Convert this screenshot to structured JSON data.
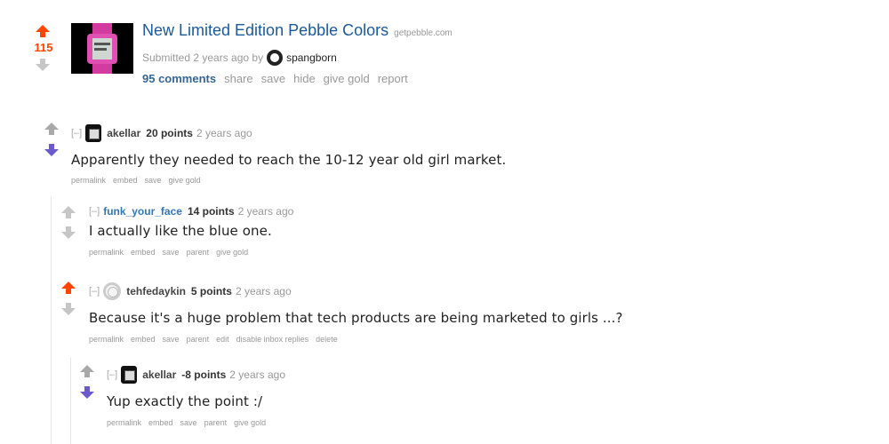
{
  "post": {
    "score": "115",
    "title": "New Limited Edition Pebble Colors",
    "domain": "getpebble.com",
    "submitted_prefix": "Submitted 2 years ago by",
    "author": "spangborn",
    "buttons": {
      "comments": "95 comments",
      "share": "share",
      "save": "save",
      "hide": "hide",
      "give_gold": "give gold",
      "report": "report"
    }
  },
  "comments": [
    {
      "collapse": "[–]",
      "user": "akellar",
      "points": "20 points",
      "time": "2 years ago",
      "body": "Apparently they needed to reach the 10-12 year old girl market.",
      "links": [
        "permalink",
        "embed",
        "save",
        "give gold"
      ]
    },
    {
      "collapse": "[–]",
      "user": "funk_your_face",
      "points": "14 points",
      "time": "2 years ago",
      "body": "I actually like the blue one.",
      "links": [
        "permalink",
        "embed",
        "save",
        "parent",
        "give gold"
      ]
    },
    {
      "collapse": "[–]",
      "user": "tehfedaykin",
      "points": "5 points",
      "time": "2 years ago",
      "body": "Because it's a huge problem that tech products are being marketed to girls ...?",
      "links": [
        "permalink",
        "embed",
        "save",
        "parent",
        "edit",
        "disable inbox replies",
        "delete"
      ]
    },
    {
      "collapse": "[–]",
      "user": "akellar",
      "points": "-8 points",
      "time": "2 years ago",
      "body": "Yup exactly the point :/",
      "links": [
        "permalink",
        "embed",
        "save",
        "parent",
        "give gold"
      ]
    }
  ],
  "colors": {
    "upvote_active": "#ff4500",
    "downvote_active": "#6a5acd",
    "arrow_inactive": "#c6c6c6",
    "title_link": "#1a5a9c",
    "user_link": "#3377bb"
  },
  "icons": {
    "upvote": "arrow-up-icon",
    "downvote": "arrow-down-icon",
    "pebble_avatar": "pebble-watch-avatar",
    "ring_avatar": "ring-avatar"
  }
}
